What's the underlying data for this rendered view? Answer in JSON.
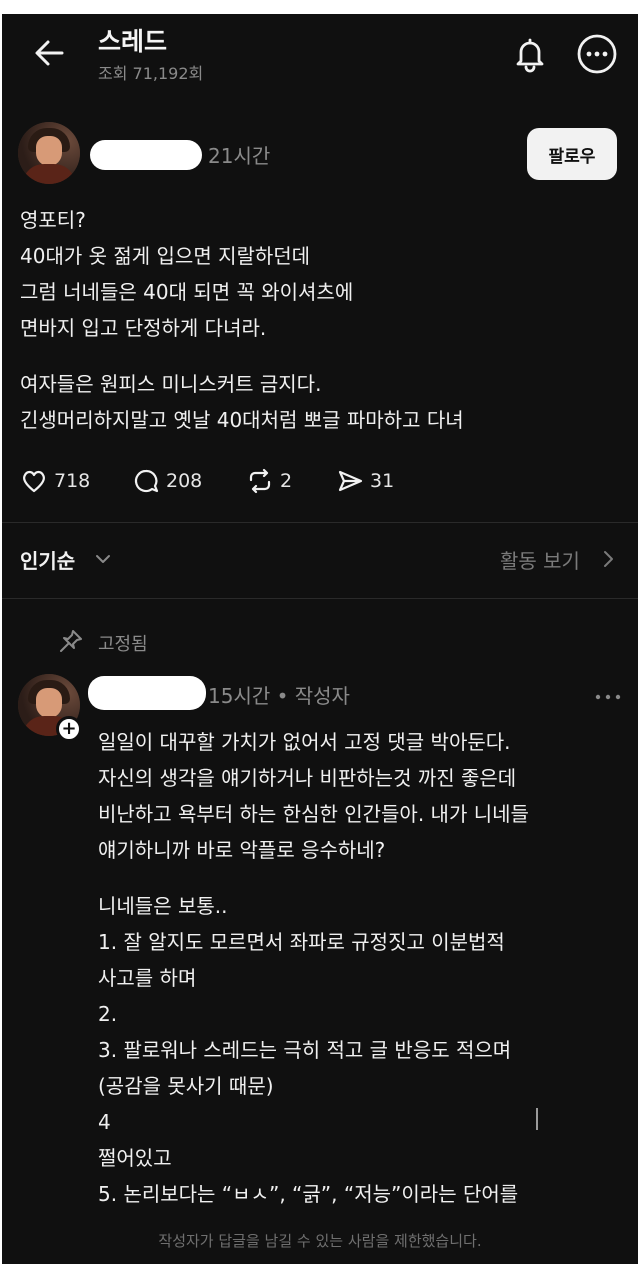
{
  "header": {
    "title": "스레드",
    "views": "조회 71,192회"
  },
  "post": {
    "time": "21시간",
    "follow_label": "팔로우",
    "paragraph1": [
      "영포티?",
      "40대가 옷 젊게 입으면 지랄하던데",
      "그럼 너네들은 40대 되면 꼭 와이셔츠에",
      "면바지 입고 단정하게 다녀라."
    ],
    "paragraph2": [
      "여자들은 원피스 미니스커트 금지다.",
      "긴생머리하지말고 옛날 40대처럼 뽀글 파마하고 다녀"
    ],
    "likes": "718",
    "comments": "208",
    "reposts": "2",
    "shares": "31"
  },
  "sort_bar": {
    "sort_label": "인기순",
    "activity_label": "활동 보기"
  },
  "comment": {
    "pinned_label": "고정됨",
    "time": "15시간 • 작성자",
    "paragraph1": [
      "일일이 대꾸할 가치가 없어서 고정 댓글 박아둔다.",
      "자신의 생각을 얘기하거나 비판하는것 까진 좋은데",
      "비난하고 욕부터 하는 한심한 인간들아. 내가 니네들",
      "얘기하니까 바로 악플로 응수하네?"
    ],
    "paragraph2": [
      "니네들은 보통..",
      "1. 잘 알지도 모르면서 좌파로 규정짓고 이분법적",
      "사고를 하며",
      "2.",
      "3. 팔로워나 스레드는 극히 적고 글 반응도 적으며",
      "(공감을 못사기 때문)",
      "4",
      "쩔어있고",
      "5. 논리보다는 “ㅂㅅ”, “긁”, “저능”이라는 단어를"
    ]
  },
  "footer": {
    "restriction_notice": "작성자가 답글을 남길 수 있는 사람을 제한했습니다."
  }
}
